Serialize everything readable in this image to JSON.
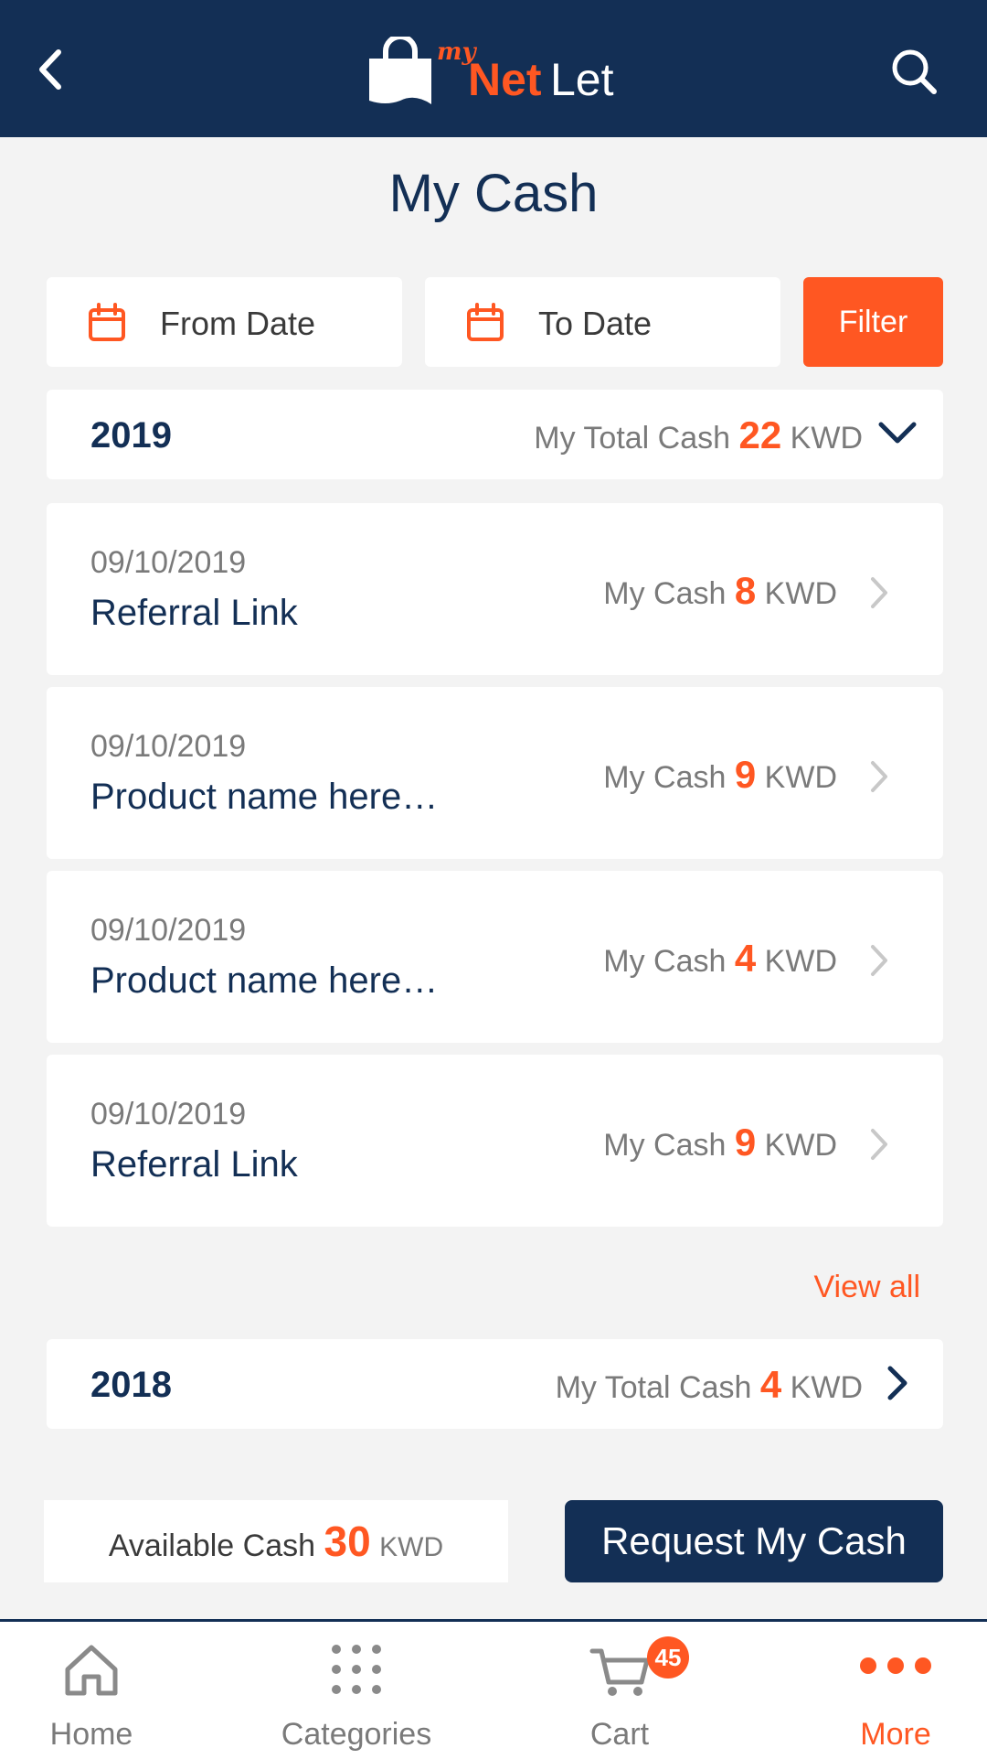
{
  "header": {
    "logo_my": "my",
    "logo_net": "Net",
    "logo_let": "Let"
  },
  "page_title": "My Cash",
  "filters": {
    "from_date_placeholder": "From Date",
    "to_date_placeholder": "To Date",
    "filter_label": "Filter"
  },
  "years": [
    {
      "year": "2019",
      "total_label": "My Total Cash",
      "total_value": "22",
      "currency": "KWD",
      "expanded": true,
      "entries": [
        {
          "date": "09/10/2019",
          "title": "Referral Link",
          "cash_label": "My Cash",
          "amount": "8",
          "currency": "KWD"
        },
        {
          "date": "09/10/2019",
          "title": "Product name here…",
          "cash_label": "My Cash",
          "amount": "9",
          "currency": "KWD"
        },
        {
          "date": "09/10/2019",
          "title": "Product name here…",
          "cash_label": "My Cash",
          "amount": "4",
          "currency": "KWD"
        },
        {
          "date": "09/10/2019",
          "title": "Referral Link",
          "cash_label": "My Cash",
          "amount": "9",
          "currency": "KWD"
        }
      ],
      "view_all": "View all"
    },
    {
      "year": "2018",
      "total_label": "My Total Cash",
      "total_value": "4",
      "currency": "KWD",
      "expanded": false
    }
  ],
  "footer_actions": {
    "available_label": "Available Cash",
    "available_value": "30",
    "available_currency": "KWD",
    "request_label": "Request My Cash"
  },
  "bottom_nav": {
    "home": "Home",
    "categories": "Categories",
    "cart": "Cart",
    "cart_badge": "45",
    "more": "More",
    "active": "more"
  },
  "colors": {
    "navy": "#132f55",
    "accent": "#ff5722",
    "background": "#f3f3f3"
  }
}
